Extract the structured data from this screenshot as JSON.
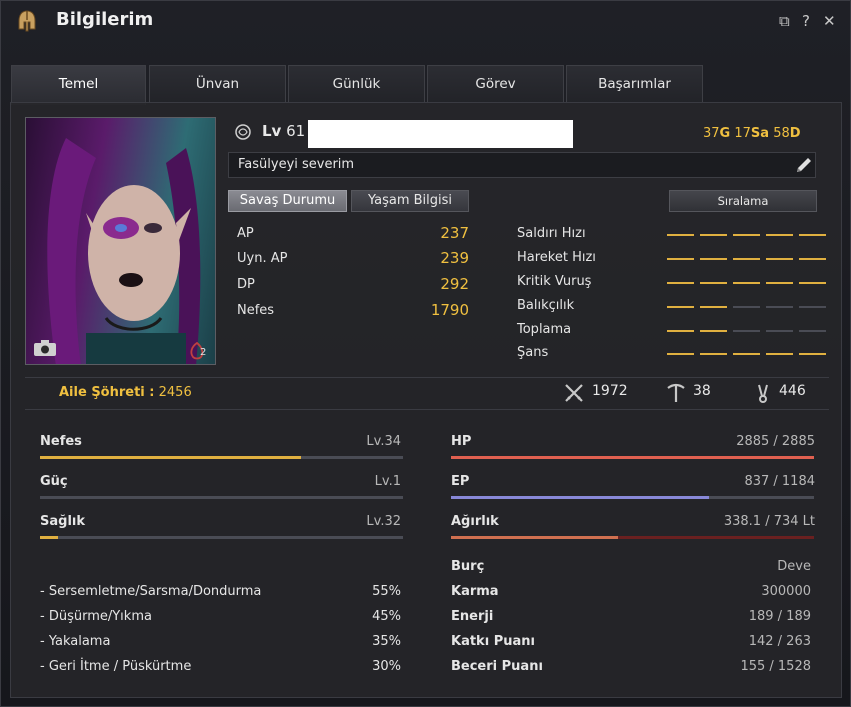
{
  "window": {
    "title": "Bilgilerim"
  },
  "tabs": [
    {
      "label": "Temel",
      "active": true
    },
    {
      "label": "Ünvan",
      "active": false
    },
    {
      "label": "Günlük",
      "active": false
    },
    {
      "label": "Görev",
      "active": false
    },
    {
      "label": "Başarımlar",
      "active": false
    }
  ],
  "profile": {
    "level_prefix": "Lv",
    "level": "61",
    "money": {
      "gold": "37",
      "gold_unit": "G",
      "silver": "17",
      "silver_unit": "Sa",
      "bronze": "58",
      "bronze_unit": "D"
    },
    "motto": "Fasülyeyi severim",
    "reputation_badge": "2"
  },
  "buttons": {
    "combat": "Savaş Durumu",
    "life": "Yaşam Bilgisi",
    "ranking": "Sıralama"
  },
  "stats": [
    {
      "label": "AP",
      "value": "237"
    },
    {
      "label": "Uyn. AP",
      "value": "239"
    },
    {
      "label": "DP",
      "value": "292"
    },
    {
      "label": "Nefes",
      "value": "1790"
    }
  ],
  "substats": [
    {
      "label": "Saldırı Hızı",
      "level": 5,
      "max": 5
    },
    {
      "label": "Hareket Hızı",
      "level": 5,
      "max": 5
    },
    {
      "label": "Kritik Vuruş",
      "level": 5,
      "max": 5
    },
    {
      "label": "Balıkçılık",
      "level": 2,
      "max": 5
    },
    {
      "label": "Toplama",
      "level": 2,
      "max": 5
    },
    {
      "label": "Şans",
      "level": 5,
      "max": 5
    }
  ],
  "fame": {
    "label": "Aile Şöhreti :",
    "value": "2456"
  },
  "fame_stats": [
    {
      "icon": "crossed-swords-icon",
      "value": "1972"
    },
    {
      "icon": "pickaxe-icon",
      "value": "38"
    },
    {
      "icon": "tongs-icon",
      "value": "446"
    }
  ],
  "left_bars": [
    {
      "label": "Nefes",
      "level": "Lv.34",
      "fill": 0.72,
      "color": "#e0b040"
    },
    {
      "label": "Güç",
      "level": "Lv.1",
      "fill": 0.0,
      "color": "#e0b040"
    },
    {
      "label": "Sağlık",
      "level": "Lv.32",
      "fill": 0.05,
      "color": "#e0b040"
    }
  ],
  "right_bars": [
    {
      "label": "HP",
      "value": "2885 / 2885",
      "fill": 1.0,
      "color": "#e06050"
    },
    {
      "label": "EP",
      "value": "837 / 1184",
      "fill": 0.71,
      "color": "#8888d8"
    },
    {
      "label": "Ağırlık",
      "value": "338.1 / 734 Lt",
      "fill": 0.46,
      "color": "#d07050"
    }
  ],
  "resistances": [
    {
      "label": "- Sersemletme/Sarsma/Dondurma",
      "value": "55%"
    },
    {
      "label": "- Düşürme/Yıkma",
      "value": "45%"
    },
    {
      "label": "- Yakalama",
      "value": "35%"
    },
    {
      "label": "- Geri İtme / Püskürtme",
      "value": "30%"
    }
  ],
  "info": [
    {
      "label": "Burç",
      "value": "Deve"
    },
    {
      "label": "Karma",
      "value": "300000"
    },
    {
      "label": "Enerji",
      "value": "189 / 189"
    },
    {
      "label": "Katkı Puanı",
      "value": "142 / 263"
    },
    {
      "label": "Beceri Puanı",
      "value": "155 / 1528"
    }
  ]
}
